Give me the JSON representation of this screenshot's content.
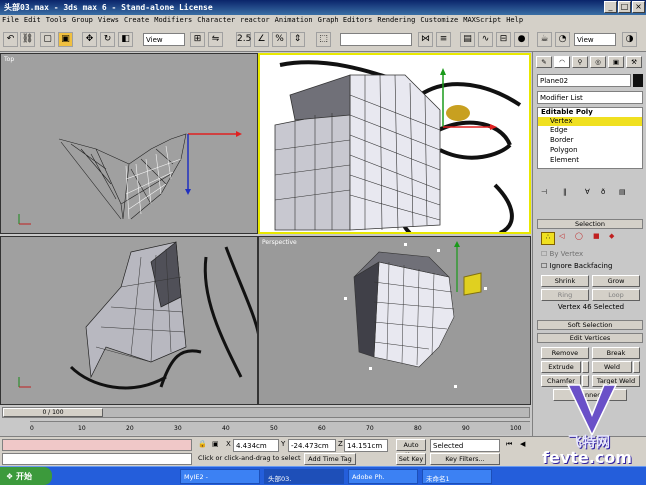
{
  "window": {
    "title": "头部03.max - 3ds max 6 - Stand-alone License"
  },
  "menu": [
    "File",
    "Edit",
    "Tools",
    "Group",
    "Views",
    "Create",
    "Modifiers",
    "Character",
    "reactor",
    "Animation",
    "Graph Editors",
    "Rendering",
    "Customize",
    "MAXScript",
    "Help"
  ],
  "toolbar": {
    "view_dropdown": "View",
    "view_dropdown2": "View",
    "snap_value": "2.5"
  },
  "viewports": {
    "top": "Top",
    "front": "",
    "left": "",
    "perspective": "Perspective"
  },
  "command_panel": {
    "object_name": "Plane02",
    "modifier_list": "Modifier List",
    "stack": [
      "Editable Poly",
      "Vertex",
      "Edge",
      "Border",
      "Polygon",
      "Element"
    ],
    "selection_title": "Selection",
    "by_vertex": "By Vertex",
    "ignore_backfacing": "Ignore Backfacing",
    "shrink": "Shrink",
    "grow": "Grow",
    "ring": "Ring",
    "loop": "Loop",
    "selected_info": "Vertex 46 Selected",
    "soft_selection": "Soft Selection",
    "edit_vertices": "Edit Vertices",
    "remove": "Remove",
    "break": "Break",
    "extrude": "Extrude",
    "weld": "Weld",
    "chamfer": "Chamfer",
    "target_weld": "Target Weld",
    "connect": "Connect"
  },
  "timeline": {
    "frame": "0 / 100",
    "ticks": [
      "0",
      "10",
      "20",
      "30",
      "40",
      "50",
      "60",
      "70",
      "80",
      "90",
      "100"
    ]
  },
  "status": {
    "x": "4.434cm",
    "y": "-24.473cm",
    "z": "14.151cm",
    "prompt": "Click or click-and-drag to select ob",
    "add_time_tag": "Add Time Tag",
    "auto_key": "Auto Key",
    "set_key": "Set Key",
    "selected": "Selected",
    "key_filters": "Key Filters..."
  },
  "taskbar": {
    "start": "开始",
    "tasks": [
      "MyIE2 -",
      "头部03.",
      "Adobe Ph.",
      "未命名1"
    ]
  },
  "watermark": {
    "text": "飞特网",
    "url": "fevte.com"
  },
  "colors": {
    "title": "#0a246a",
    "viewport_bg": "#9a9a9a",
    "active_border": "#f0f000",
    "selected_stack": "#f0e020"
  }
}
